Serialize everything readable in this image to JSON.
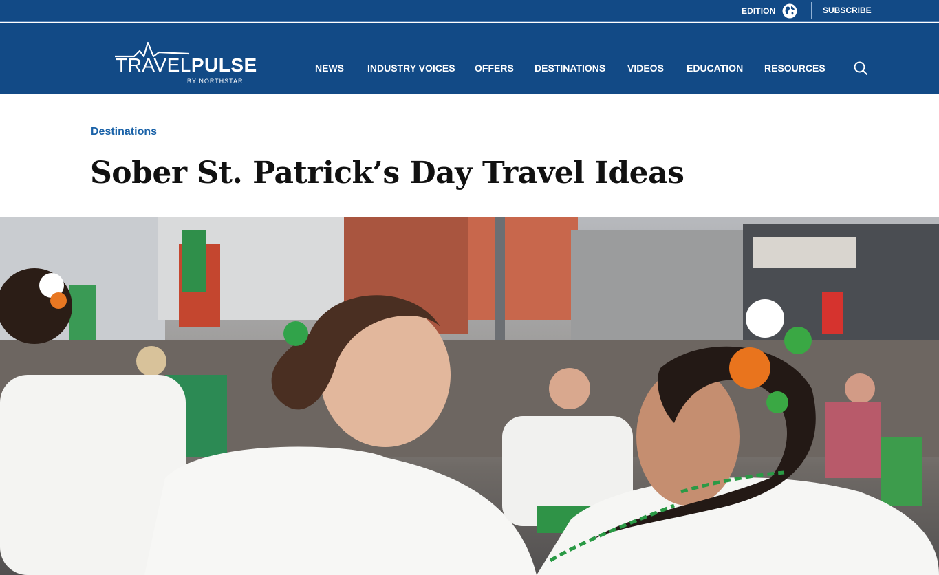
{
  "topbar": {
    "edition_label": "EDITION",
    "subscribe_label": "SUBSCRIBE"
  },
  "logo": {
    "part1": "TRAVEL",
    "part2": "PULSE",
    "byline": "BY NORTHSTAR"
  },
  "nav": {
    "items": [
      "NEWS",
      "INDUSTRY VOICES",
      "OFFERS",
      "DESTINATIONS",
      "VIDEOS",
      "EDUCATION",
      "RESOURCES"
    ]
  },
  "article": {
    "category": "Destinations",
    "title": "Sober St. Patrick’s Day Travel Ideas"
  },
  "colors": {
    "header_blue": "#124a86",
    "category_blue": "#1a62a8",
    "title_black": "#111111"
  },
  "icons": [
    "globe-icon",
    "search-icon",
    "travelpulse-logo"
  ]
}
